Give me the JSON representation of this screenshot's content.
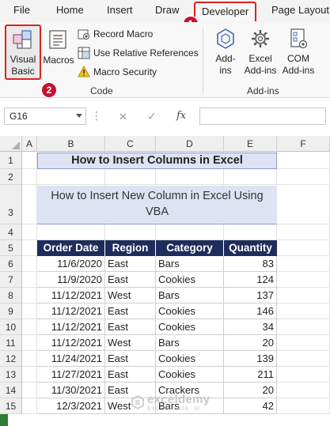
{
  "ribbon_tabs": [
    "File",
    "Home",
    "Insert",
    "Draw",
    "Developer",
    "Page Layout"
  ],
  "active_tab": "Developer",
  "ribbon": {
    "code_group": {
      "visual_basic_line1": "Visual",
      "visual_basic_line2": "Basic",
      "macros": "Macros",
      "record_macro": "Record Macro",
      "use_relative_references": "Use Relative References",
      "macro_security": "Macro Security",
      "label": "Code"
    },
    "addins_group": {
      "addins_line1": "Add-",
      "addins_line2": "ins",
      "excel_addins_line1": "Excel",
      "excel_addins_line2": "Add-ins",
      "com_addins_line1": "COM",
      "com_addins_line2": "Add-ins",
      "label": "Add-ins"
    }
  },
  "badges": {
    "developer_step": "1",
    "visual_basic_step": "2"
  },
  "formula_bar": {
    "name_box": "G16",
    "cancel_symbol": "✕",
    "enter_symbol": "✓",
    "fx_symbol": "fx",
    "formula": ""
  },
  "columns": [
    "A",
    "B",
    "C",
    "D",
    "E",
    "F"
  ],
  "rows": [
    "1",
    "2",
    "3",
    "4",
    "5",
    "6",
    "7",
    "8",
    "9",
    "10",
    "11",
    "12",
    "13",
    "14",
    "15"
  ],
  "sheet": {
    "title": "How to Insert Columns in Excel",
    "subtitle_line1": "How to Insert New Column in Excel Using",
    "subtitle_line2": "VBA",
    "headers": [
      "Order Date",
      "Region",
      "Category",
      "Quantity"
    ],
    "records": [
      [
        "11/6/2020",
        "East",
        "Bars",
        "83"
      ],
      [
        "11/9/2020",
        "East",
        "Cookies",
        "124"
      ],
      [
        "11/12/2021",
        "West",
        "Bars",
        "137"
      ],
      [
        "11/12/2021",
        "East",
        "Cookies",
        "146"
      ],
      [
        "11/12/2021",
        "East",
        "Cookies",
        "34"
      ],
      [
        "11/12/2021",
        "West",
        "Bars",
        "20"
      ],
      [
        "11/24/2021",
        "East",
        "Cookies",
        "139"
      ],
      [
        "11/27/2021",
        "East",
        "Cookies",
        "211"
      ],
      [
        "11/30/2021",
        "East",
        "Crackers",
        "20"
      ],
      [
        "12/3/2021",
        "West",
        "Bars",
        "42"
      ]
    ]
  },
  "watermark": {
    "name": "exceldemy",
    "tagline": "EXCEL · DATA · BI"
  },
  "colors": {
    "header_fill": "#1f2d5c",
    "title_fill": "#dde3f3",
    "highlight_red": "#e02020",
    "badge_red": "#c8102e"
  }
}
